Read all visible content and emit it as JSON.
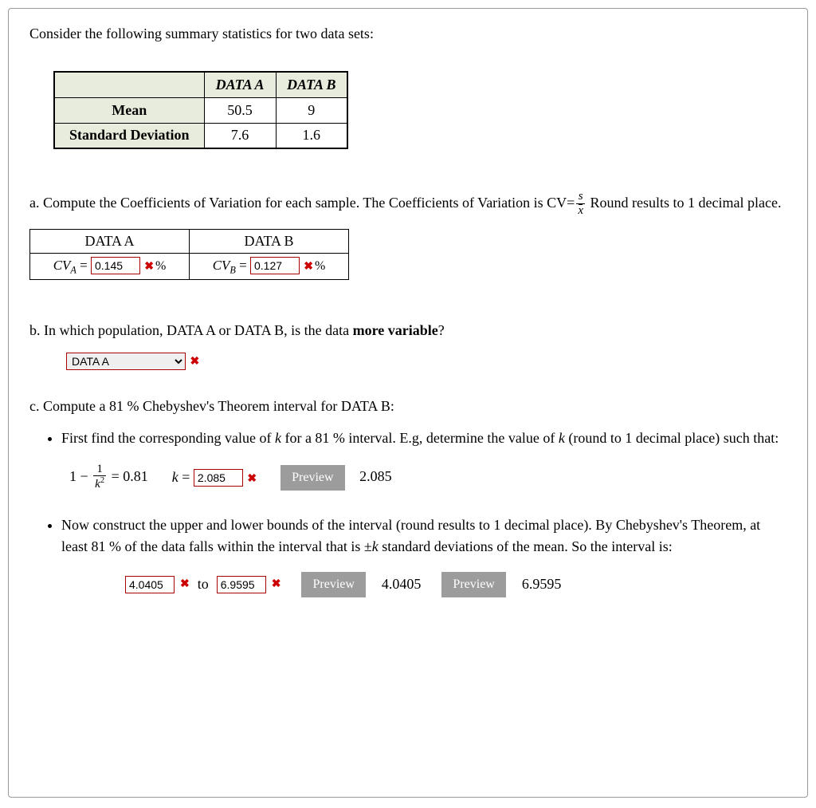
{
  "intro": "Consider the following summary statistics for two data sets:",
  "summary_table": {
    "col_a": "DATA A",
    "col_b": "DATA B",
    "row_mean": "Mean",
    "row_sd": "Standard Deviation",
    "mean_a": "50.5",
    "mean_b": "9",
    "sd_a": "7.6",
    "sd_b": "1.6"
  },
  "part_a": {
    "prefix": "a. Compute the Coefficients of Variation for each sample.  The Coefficients of Variation is CV=",
    "suffix": " Round results to 1 decimal place.",
    "frac_num": "s",
    "frac_den_x": "x",
    "col_a": "DATA A",
    "col_b": "DATA B",
    "cva_label_cv": "CV",
    "cva_label_sub": "A",
    "cva_value": "0.145",
    "cvb_label_cv": "CV",
    "cvb_label_sub": "B",
    "cvb_value": "0.127",
    "eq": " = ",
    "pct": "%"
  },
  "part_b": {
    "text_pre": "b. In which population, DATA A or DATA B, is the data ",
    "text_bold": "more variable",
    "text_post": "?",
    "selected": "DATA A"
  },
  "part_c": {
    "heading": "c. Compute a 81 % Chebyshev's Theorem interval for DATA B:",
    "bullet1_a": "First find the corresponding value of ",
    "bullet1_k1": "k",
    "bullet1_b": " for a 81 % interval. E.g, determine the value of ",
    "bullet1_k2": "k",
    "bullet1_c": " (round to 1 decimal place) such that:",
    "eq_lhs_one": "1",
    "eq_lhs_minus": " − ",
    "eq_frac_num": "1",
    "eq_frac_den": "k",
    "eq_frac_den_sup": "2",
    "eq_equals": " =  0.81",
    "k_label": "k",
    "k_eq": " = ",
    "k_value": "2.085",
    "preview_label": "Preview",
    "k_preview": "2.085",
    "bullet2_a": "Now construct the upper and lower bounds of the interval (round results to 1 decimal place). By Chebyshev's Theorem, at least 81 % of the data falls within the interval that is ",
    "bullet2_pm": "±",
    "bullet2_k": "k",
    "bullet2_b": " standard deviations of the mean. So the interval is:",
    "lower": "4.0405",
    "to": "to",
    "upper": "6.9595",
    "lower_preview": "4.0405",
    "upper_preview": "6.9595"
  }
}
